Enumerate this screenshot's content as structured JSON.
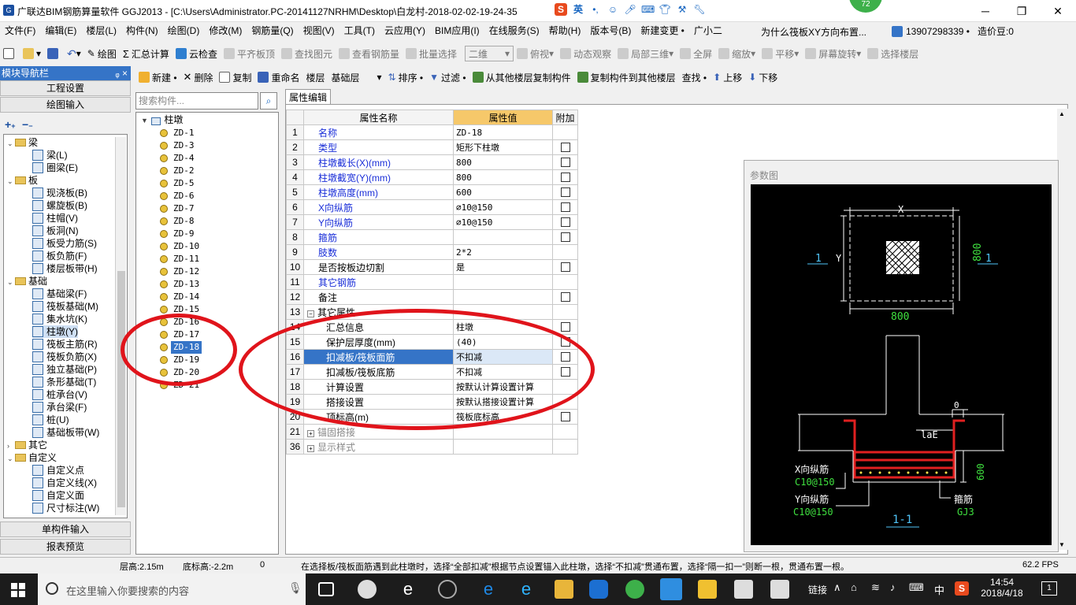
{
  "window": {
    "title": "广联达BIM钢筋算量软件 GGJ2013 - [C:\\Users\\Administrator.PC-20141127NRHM\\Desktop\\白龙村-2018-02-02-19-24-35",
    "ime_lang": "英",
    "badge": "72",
    "minimize": "─",
    "maximize": "❐",
    "close": "✕"
  },
  "menubar": {
    "items": [
      "文件(F)",
      "编辑(E)",
      "楼层(L)",
      "构件(N)",
      "绘图(D)",
      "修改(M)",
      "钢筋量(Q)",
      "视图(V)",
      "工具(T)",
      "云应用(Y)",
      "BIM应用(I)",
      "在线服务(S)",
      "帮助(H)",
      "版本号(B)",
      "新建变更 •",
      "广小二"
    ],
    "question": "为什么筏板XY方向布置...",
    "phone": "13907298339 •",
    "beans": "造价豆:0"
  },
  "toolbar1": {
    "draw": "绘图",
    "sum": "汇总计算",
    "cloud_check": "云检查",
    "flat_top": "平齐板顶",
    "find": "查找图元",
    "view_rebar": "查看钢筋量",
    "batch_select": "批量选择",
    "view2d": "二维",
    "ortho": "俯视",
    "dynamic": "动态观察",
    "local3d": "局部三维",
    "fullscreen": "全屏",
    "zoom": "缩放",
    "pan": "平移",
    "rotate": "屏幕旋转",
    "select_layer": "选择楼层"
  },
  "nav": {
    "header": "模块导航栏",
    "pin": "ᵩ ×",
    "btn_project": "工程设置",
    "btn_draw": "绘图输入",
    "btn_single": "单构件输入",
    "btn_report": "报表预览",
    "tree": [
      {
        "type": "group",
        "label": "梁"
      },
      {
        "type": "item",
        "label": "梁(L)"
      },
      {
        "type": "item",
        "label": "圈梁(E)"
      },
      {
        "type": "group",
        "label": "板"
      },
      {
        "type": "item",
        "label": "现浇板(B)"
      },
      {
        "type": "item",
        "label": "螺旋板(B)"
      },
      {
        "type": "item",
        "label": "柱帽(V)"
      },
      {
        "type": "item",
        "label": "板洞(N)"
      },
      {
        "type": "item",
        "label": "板受力筋(S)"
      },
      {
        "type": "item",
        "label": "板负筋(F)"
      },
      {
        "type": "item",
        "label": "楼层板带(H)"
      },
      {
        "type": "group",
        "label": "基础"
      },
      {
        "type": "item",
        "label": "基础梁(F)"
      },
      {
        "type": "item",
        "label": "筏板基础(M)"
      },
      {
        "type": "item",
        "label": "集水坑(K)"
      },
      {
        "type": "item",
        "label": "柱墩(Y)"
      },
      {
        "type": "item",
        "label": "筏板主筋(R)"
      },
      {
        "type": "item",
        "label": "筏板负筋(X)"
      },
      {
        "type": "item",
        "label": "独立基础(P)"
      },
      {
        "type": "item",
        "label": "条形基础(T)"
      },
      {
        "type": "item",
        "label": "桩承台(V)"
      },
      {
        "type": "item",
        "label": "承台梁(F)"
      },
      {
        "type": "item",
        "label": "桩(U)"
      },
      {
        "type": "item",
        "label": "基础板带(W)"
      },
      {
        "type": "group",
        "label": "其它"
      },
      {
        "type": "group",
        "label": "自定义"
      },
      {
        "type": "item",
        "label": "自定义点"
      },
      {
        "type": "item",
        "label": "自定义线(X)"
      },
      {
        "type": "item",
        "label": "自定义面"
      },
      {
        "type": "item",
        "label": "尺寸标注(W)"
      }
    ]
  },
  "comp_toolbar": {
    "new": "新建 •",
    "delete": "删除",
    "copy": "复制",
    "rename": "重命名",
    "floor_label": "楼层",
    "floor_value": "基础层",
    "sort": "排序 •",
    "filter": "过滤 •",
    "copy_from": "从其他楼层复制构件",
    "copy_to": "复制构件到其他楼层",
    "find": "查找 •",
    "up": "上移",
    "down": "下移"
  },
  "complist": {
    "search_placeholder": "搜索构件...",
    "root": "柱墩",
    "items": [
      "ZD-1",
      "ZD-3",
      "ZD-4",
      "ZD-2",
      "ZD-5",
      "ZD-6",
      "ZD-7",
      "ZD-8",
      "ZD-9",
      "ZD-10",
      "ZD-11",
      "ZD-12",
      "ZD-13",
      "ZD-14",
      "ZD-15",
      "ZD-16",
      "ZD-17",
      "ZD-18",
      "ZD-19",
      "ZD-20",
      "ZD-21"
    ],
    "selected": "ZD-18"
  },
  "props": {
    "tab": "属性编辑",
    "header_name": "属性名称",
    "header_value": "属性值",
    "header_add": "附加",
    "rows": [
      {
        "n": "1",
        "name": "名称",
        "value": "ZD-18",
        "blue": true,
        "chk": false,
        "indent": 0
      },
      {
        "n": "2",
        "name": "类型",
        "value": "矩形下柱墩",
        "blue": true,
        "chk": true,
        "indent": 0
      },
      {
        "n": "3",
        "name": "柱墩截长(X)(mm)",
        "value": "800",
        "blue": true,
        "chk": true,
        "indent": 0
      },
      {
        "n": "4",
        "name": "柱墩截宽(Y)(mm)",
        "value": "800",
        "blue": true,
        "chk": true,
        "indent": 0
      },
      {
        "n": "5",
        "name": "柱墩高度(mm)",
        "value": "600",
        "blue": true,
        "chk": true,
        "indent": 0
      },
      {
        "n": "6",
        "name": "X向纵筋",
        "value": "⌀10@150",
        "blue": true,
        "chk": true,
        "indent": 0
      },
      {
        "n": "7",
        "name": "Y向纵筋",
        "value": "⌀10@150",
        "blue": true,
        "chk": true,
        "indent": 0
      },
      {
        "n": "8",
        "name": "箍筋",
        "value": "",
        "blue": true,
        "chk": true,
        "indent": 0
      },
      {
        "n": "9",
        "name": "肢数",
        "value": "2*2",
        "blue": true,
        "chk": false,
        "indent": 0
      },
      {
        "n": "10",
        "name": "是否按板边切割",
        "value": "是",
        "blue": false,
        "chk": true,
        "indent": 0
      },
      {
        "n": "11",
        "name": "其它钢筋",
        "value": "",
        "blue": true,
        "chk": false,
        "indent": 0
      },
      {
        "n": "12",
        "name": "备注",
        "value": "",
        "blue": false,
        "chk": true,
        "indent": 0
      },
      {
        "n": "13",
        "name": "其它属性",
        "value": "",
        "blue": false,
        "chk": false,
        "indent": 0,
        "group": "minus"
      },
      {
        "n": "14",
        "name": "汇总信息",
        "value": "柱墩",
        "blue": false,
        "chk": true,
        "indent": 1
      },
      {
        "n": "15",
        "name": "保护层厚度(mm)",
        "value": "(40)",
        "blue": false,
        "chk": true,
        "indent": 1
      },
      {
        "n": "16",
        "name": "扣减板/筏板面筋",
        "value": "不扣减",
        "blue": false,
        "chk": true,
        "indent": 1,
        "selected": true
      },
      {
        "n": "17",
        "name": "扣减板/筏板底筋",
        "value": "不扣减",
        "blue": false,
        "chk": true,
        "indent": 1
      },
      {
        "n": "18",
        "name": "计算设置",
        "value": "按默认计算设置计算",
        "blue": false,
        "chk": false,
        "indent": 1
      },
      {
        "n": "19",
        "name": "搭接设置",
        "value": "按默认搭接设置计算",
        "blue": false,
        "chk": false,
        "indent": 1
      },
      {
        "n": "20",
        "name": "顶标高(m)",
        "value": "筏板底标高",
        "blue": false,
        "chk": true,
        "indent": 1
      },
      {
        "n": "21",
        "name": "锚固搭接",
        "value": "",
        "blue": false,
        "chk": false,
        "indent": 0,
        "group": "plus",
        "gray": true
      },
      {
        "n": "36",
        "name": "显示样式",
        "value": "",
        "blue": false,
        "chk": false,
        "indent": 0,
        "group": "plus",
        "gray": true
      }
    ]
  },
  "diagram": {
    "title": "参数图",
    "x_label": "X",
    "y_label": "Y",
    "dim_x": "800",
    "dim_y": "800",
    "section_mark": "1",
    "dim_cover": "0",
    "lae": "laE",
    "dim_h": "600",
    "x_rebar_label": "X向纵筋",
    "x_rebar_spec": "C10@150",
    "y_rebar_label": "Y向纵筋",
    "y_rebar_spec": "C10@150",
    "stirrup_label": "箍筋",
    "stirrup_spec": "GJ3",
    "section_label": "1-1"
  },
  "status": {
    "floor_height": "层高:2.15m",
    "bottom_elev": "底标高:-2.2m",
    "zero": "0",
    "hint": "在选择板/筏板面筋遇到此柱墩时，选择“全部扣减”根据节点设置锚入此柱墩，选择“不扣减”贯通布置，选择“隔一扣一”则断一根，贯通布置一根。",
    "fps": "62.2 FPS"
  },
  "taskbar": {
    "search_placeholder": "在这里输入你要搜索的内容",
    "link": "链接",
    "lang": "中",
    "time": "14:54",
    "date": "2018/4/18",
    "notify_count": "1"
  },
  "colors": {
    "accent_blue": "#3574c7",
    "annotation_red": "#e0141b",
    "header_orange": "#f6c86a"
  }
}
